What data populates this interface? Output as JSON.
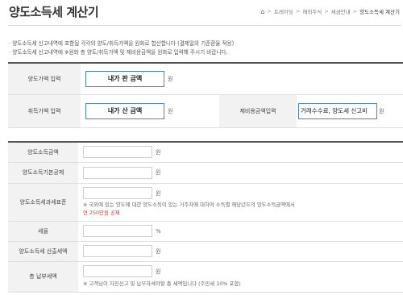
{
  "title": "양도소득세 계산기",
  "breadcrumb": [
    "트레이딩",
    "해외주식",
    "세금안내",
    "양도소득세 계산기"
  ],
  "notes": [
    "양도소득세 신고내역에 포함될 각각의 양도/취득가액을 원화로 합산합니다 (결제일의 기준환율 적용)",
    "양도소득세 신고내역에 ※원화 총 양도/취득가액 및 제비용금액을 원화로 입력해 주시기 바랍니다."
  ],
  "inputs": {
    "sell_label": "양도가액 입력",
    "sell_value": "내가 판 금액",
    "buy_label": "취득가액 입력",
    "buy_value": "내가 산 금액",
    "expense_label": "제비용금액입력",
    "expense_value": "거래수수료, 양도세 신고비",
    "unit": "원"
  },
  "results": {
    "gain_label": "양도소득금액",
    "basic_deduction_label": "양도소득기본공제",
    "tax_base_label": "양도소득세과세표준",
    "tax_base_note_prefix": "※ 국외에 있는 양도에 대한 양도소득이 있는 거주자에 대하여 소득별 해당년도의 양도소득금액에서",
    "tax_base_note_red": "연 250만원 공제",
    "rate_label": "세율",
    "rate_unit": "%",
    "calc_tax_label": "양도소득세 산출세액",
    "total_label": "총 납부세액",
    "total_note": "※ 고객님이 자진신고 및 납부하셔야할 총 세액입니다 (주민세 10% 포함)",
    "unit": "원"
  }
}
